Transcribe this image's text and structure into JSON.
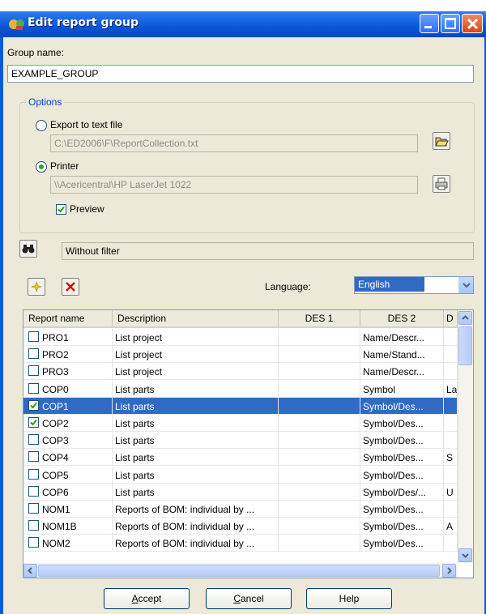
{
  "window": {
    "title": "Edit report group"
  },
  "group_name": {
    "label": "Group name:",
    "value": "EXAMPLE_GROUP"
  },
  "options": {
    "legend": "Options",
    "export_label": "Export to text file",
    "export_path": "C:\\ED2006\\F\\ReportCollection.txt",
    "printer_label": "Printer",
    "printer_path": "\\\\Acericentral\\HP LaserJet 1022",
    "preview_label": "Preview"
  },
  "filter": {
    "value": "Without filter"
  },
  "language": {
    "label": "Language:",
    "value": "English"
  },
  "table": {
    "headers": [
      "Report name",
      "Description",
      "DES 1",
      "DES 2",
      "D"
    ],
    "rows": [
      {
        "name": "PRO1",
        "desc": "List project",
        "des1": "",
        "des2": "Name/Descr...",
        "d": "",
        "checked": false,
        "selected": false
      },
      {
        "name": "PRO2",
        "desc": "List project",
        "des1": "",
        "des2": "Name/Stand...",
        "d": "",
        "checked": false,
        "selected": false
      },
      {
        "name": "PRO3",
        "desc": "List project",
        "des1": "",
        "des2": "Name/Descr...",
        "d": "",
        "checked": false,
        "selected": false
      },
      {
        "name": "COP0",
        "desc": "List parts",
        "des1": "",
        "des2": "Symbol",
        "d": "La",
        "checked": false,
        "selected": false
      },
      {
        "name": "COP1",
        "desc": "List parts",
        "des1": "",
        "des2": "Symbol/Des...",
        "d": "",
        "checked": true,
        "selected": true
      },
      {
        "name": "COP2",
        "desc": "List parts",
        "des1": "",
        "des2": "Symbol/Des...",
        "d": "",
        "checked": true,
        "selected": false
      },
      {
        "name": "COP3",
        "desc": "List parts",
        "des1": "",
        "des2": "Symbol/Des...",
        "d": "",
        "checked": false,
        "selected": false
      },
      {
        "name": "COP4",
        "desc": "List parts",
        "des1": "",
        "des2": "Symbol/Des...",
        "d": "S",
        "checked": false,
        "selected": false
      },
      {
        "name": "COP5",
        "desc": "List parts",
        "des1": "",
        "des2": "Symbol/Des...",
        "d": "",
        "checked": false,
        "selected": false
      },
      {
        "name": "COP6",
        "desc": "List parts",
        "des1": "",
        "des2": "Symbol/Des/...",
        "d": "U",
        "checked": false,
        "selected": false
      },
      {
        "name": "NOM1",
        "desc": "Reports of BOM: individual by ...",
        "des1": "",
        "des2": "Symbol/Des...",
        "d": "",
        "checked": false,
        "selected": false
      },
      {
        "name": "NOM1B",
        "desc": "Reports of BOM: individual by ...",
        "des1": "",
        "des2": "Symbol/Des...",
        "d": "A",
        "checked": false,
        "selected": false
      },
      {
        "name": "NOM2",
        "desc": "Reports of BOM: individual by ...",
        "des1": "",
        "des2": "Symbol/Des...",
        "d": "",
        "checked": false,
        "selected": false
      }
    ]
  },
  "buttons": {
    "accept": "Accept",
    "cancel": "Cancel",
    "help": "Help"
  },
  "icons": {
    "browse": "folder-open-icon",
    "print": "printer-icon",
    "filter": "binoculars-icon",
    "add": "add-star-icon",
    "delete": "delete-x-icon"
  }
}
